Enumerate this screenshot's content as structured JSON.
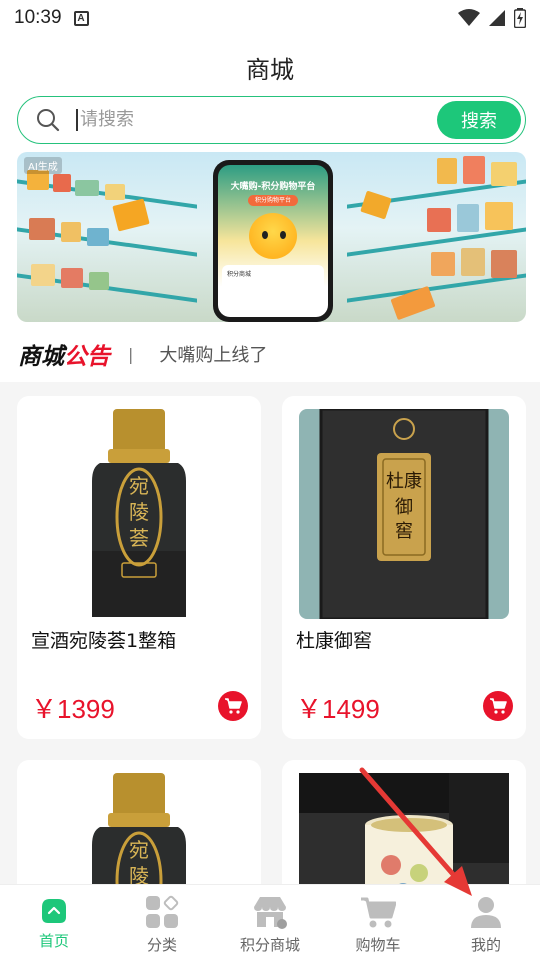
{
  "status_bar": {
    "time": "10:39",
    "notification_icon": "A"
  },
  "header": {
    "title": "商城"
  },
  "search": {
    "placeholder": "请搜索",
    "button_label": "搜索"
  },
  "banner": {
    "ai_tag": "AI生成",
    "phone_title": "大嘴购-积分购物平台",
    "phone_pill": "积分购物平台",
    "phone_card_label": "积分商城"
  },
  "notice": {
    "title_black": "商城",
    "title_red": "公告",
    "separator": "|",
    "message": "大嘴购上线了"
  },
  "products": [
    {
      "name": "宣酒宛陵荟1整箱",
      "price": "￥1399",
      "label_text": "宛陵荟"
    },
    {
      "name": "杜康御窖",
      "price": "￥1499",
      "label_text": "杜康御窖"
    },
    {
      "name": "",
      "price": "",
      "label_text": "宛陵荟"
    },
    {
      "name": "",
      "price": ""
    }
  ],
  "bottom_nav": [
    {
      "label": "首页",
      "icon": "home-icon",
      "active": true
    },
    {
      "label": "分类",
      "icon": "category-icon",
      "active": false
    },
    {
      "label": "积分商城",
      "icon": "store-icon",
      "active": false
    },
    {
      "label": "购物车",
      "icon": "cart-icon",
      "active": false
    },
    {
      "label": "我的",
      "icon": "profile-icon",
      "active": false
    }
  ],
  "colors": {
    "accent": "#1dc77a",
    "price_red": "#e8132b",
    "notice_red": "#e8132b",
    "arrow_red": "#e53935"
  }
}
